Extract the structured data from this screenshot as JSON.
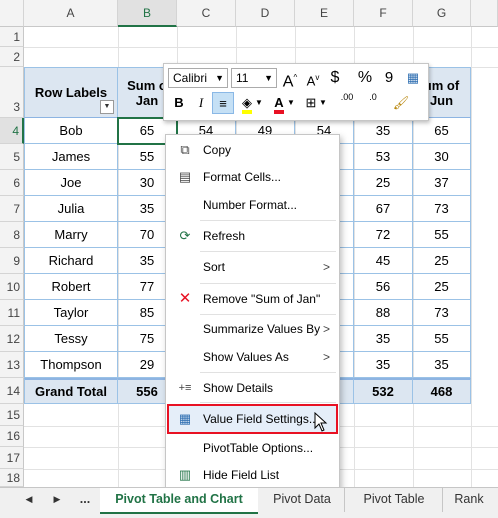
{
  "columns": [
    "A",
    "B",
    "C",
    "D",
    "E",
    "F",
    "G"
  ],
  "rows": [
    "1",
    "2",
    "3",
    "4",
    "5",
    "6",
    "7",
    "8",
    "9",
    "10",
    "11",
    "12",
    "13",
    "14",
    "15",
    "16"
  ],
  "pivot": {
    "header_row_labels": "Row Labels",
    "header_b_line1": "Sum o",
    "header_b_line2": "Jan",
    "header_g_line1": "um of",
    "header_g_line2": "Jun",
    "body": [
      {
        "name": "Bob",
        "b": "65",
        "c": "54",
        "d": "49",
        "e": "54",
        "f": "35",
        "g": "65"
      },
      {
        "name": "James",
        "b": "55",
        "c": "",
        "d": "",
        "e": "",
        "f": "53",
        "g": "30"
      },
      {
        "name": "Joe",
        "b": "30",
        "c": "",
        "d": "",
        "e": "",
        "f": "25",
        "g": "37"
      },
      {
        "name": "Julia",
        "b": "35",
        "c": "",
        "d": "",
        "e": "",
        "f": "67",
        "g": "73"
      },
      {
        "name": "Marry",
        "b": "70",
        "c": "",
        "d": "",
        "e": "",
        "f": "72",
        "g": "55"
      },
      {
        "name": "Richard",
        "b": "35",
        "c": "",
        "d": "",
        "e": "",
        "f": "45",
        "g": "25"
      },
      {
        "name": "Robert",
        "b": "77",
        "c": "",
        "d": "",
        "e": "",
        "f": "56",
        "g": "25"
      },
      {
        "name": "Taylor",
        "b": "85",
        "c": "",
        "d": "",
        "e": "",
        "f": "88",
        "g": "73"
      },
      {
        "name": "Tessy",
        "b": "75",
        "c": "",
        "d": "",
        "e": "",
        "f": "35",
        "g": "55"
      },
      {
        "name": "Thompson",
        "b": "29",
        "c": "",
        "d": "",
        "e": "",
        "f": "35",
        "g": "35"
      }
    ],
    "grand_total": {
      "name": "Grand Total",
      "b": "556",
      "f": "532",
      "g": "468"
    }
  },
  "mini_toolbar": {
    "font_name": "Calibri",
    "font_size": "11",
    "grow_font": "A",
    "shrink_font": "A",
    "currency": "$",
    "percent": "%",
    "comma": "9",
    "bold": "B",
    "italic": "I",
    "inc_decimal": ".00",
    "dec_decimal": ".0"
  },
  "context_menu": {
    "items": [
      {
        "label": "Copy",
        "icon": "copy-icon"
      },
      {
        "label": "Format Cells...",
        "icon": "format-cells-icon"
      },
      {
        "label": "Number Format...",
        "icon": ""
      },
      {
        "label": "Refresh",
        "icon": "refresh-icon"
      },
      {
        "label": "Sort",
        "icon": "",
        "submenu": true
      },
      {
        "label": "Remove \"Sum of Jan\"",
        "icon": "remove-x-icon"
      },
      {
        "label": "Summarize Values By",
        "icon": "",
        "submenu": true
      },
      {
        "label": "Show Values As",
        "icon": "",
        "submenu": true
      },
      {
        "label": "Show Details",
        "icon": "show-details-icon"
      },
      {
        "label": "Value Field Settings...",
        "icon": "value-field-settings-icon",
        "highlighted": true
      },
      {
        "label": "PivotTable Options...",
        "icon": ""
      },
      {
        "label": "Hide Field List",
        "icon": "field-list-icon"
      }
    ],
    "submenu_arrow": ">"
  },
  "tabs": {
    "ellipsis": "...",
    "items": [
      "Pivot Table and Chart",
      "Pivot Data",
      "Pivot Table",
      "Rank"
    ],
    "active_index": 0
  },
  "colors": {
    "accent_green": "#217346",
    "pivot_header_fill": "#dce6f1",
    "highlight_border": "#e81123"
  }
}
